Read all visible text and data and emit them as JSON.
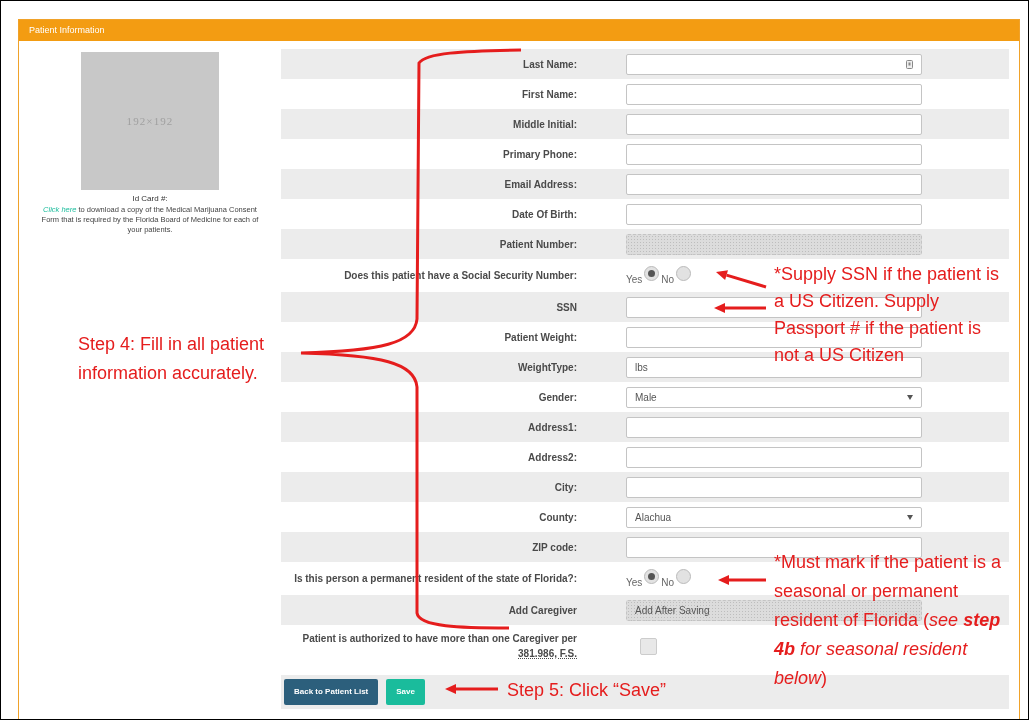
{
  "panel": {
    "title": "Patient Information"
  },
  "id_card": {
    "image_text": "192×192",
    "label": "Id Card #:",
    "link": "Click here",
    "note": " to download a copy of the Medical Marijuana Consent Form that is required by the Florida Board of Medicine for each of your patients."
  },
  "fields": [
    {
      "label": "Last Name:",
      "kind": "text",
      "disabled": false
    },
    {
      "label": "First Name:",
      "kind": "text",
      "disabled": false
    },
    {
      "label": "Middle Initial:",
      "kind": "text",
      "disabled": false
    },
    {
      "label": "Primary Phone:",
      "kind": "text",
      "disabled": false
    },
    {
      "label": "Email Address:",
      "kind": "text",
      "disabled": false
    },
    {
      "label": "Date Of Birth:",
      "kind": "text",
      "disabled": false
    },
    {
      "label": "Patient Number:",
      "kind": "text",
      "disabled": true
    },
    {
      "label": "Does this patient have a Social Security Number:",
      "kind": "radio",
      "options": [
        {
          "label": "Yes",
          "selected": true
        },
        {
          "label": "No",
          "selected": false
        }
      ]
    },
    {
      "label": "SSN",
      "kind": "text",
      "disabled": false
    },
    {
      "label": "Patient Weight:",
      "kind": "text",
      "disabled": false
    },
    {
      "label": "WeightType:",
      "kind": "text",
      "value": "lbs",
      "disabled": false
    },
    {
      "label": "Gender:",
      "kind": "select",
      "value": "Male",
      "disabled": false
    },
    {
      "label": "Address1:",
      "kind": "text",
      "disabled": false
    },
    {
      "label": "Address2:",
      "kind": "text",
      "disabled": false
    },
    {
      "label": "City:",
      "kind": "text",
      "disabled": false
    },
    {
      "label": "County:",
      "kind": "select",
      "value": "Alachua",
      "disabled": false
    },
    {
      "label": "ZIP code:",
      "kind": "text",
      "disabled": false
    },
    {
      "label": "Is this person a permanent resident of the state of Florida?:",
      "kind": "radio",
      "options": [
        {
          "label": "Yes",
          "selected": true
        },
        {
          "label": "No",
          "selected": false
        }
      ]
    },
    {
      "label": "Add Caregiver",
      "kind": "text",
      "value": "Add After Saving",
      "disabled": true
    },
    {
      "label": "Patient is authorized to have more than one Caregiver per",
      "reference": "381.986, F.S.",
      "kind": "checkbox",
      "checked": false
    }
  ],
  "buttons": [
    {
      "label": "Back to Patient List",
      "kind": "secondary"
    },
    {
      "label": "Save",
      "kind": "primary"
    }
  ],
  "annotations": [
    {
      "kind": "step4",
      "text": "Step 4: Fill in all patient information accurately."
    },
    {
      "kind": "ssn_note",
      "text": "*Supply SSN if the patient is a US Citizen. Supply Passport # if the patient is not a US Citizen"
    },
    {
      "kind": "resident_note",
      "prefix": "*",
      "text": "Must mark if the patient is a seasonal or permanent resident of Florida (*see* **step 4b** *for seasonal resident below*)"
    },
    {
      "kind": "step5",
      "text": "Step 5: Click “Save”"
    }
  ]
}
